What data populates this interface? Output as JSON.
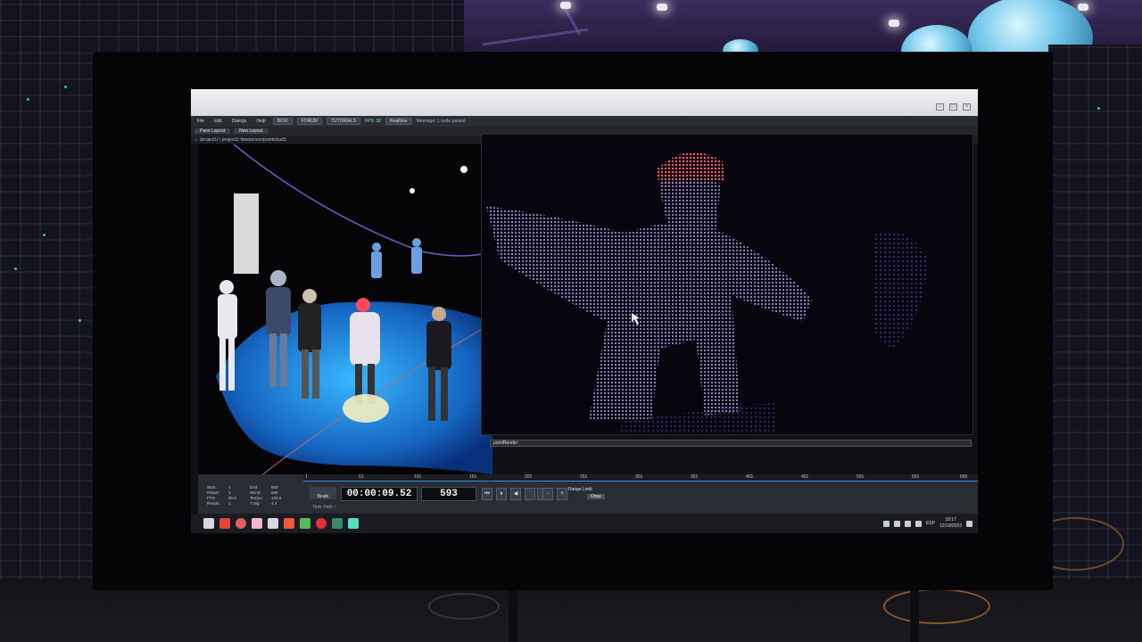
{
  "window": {
    "status_message": "Message: 1 node pasted",
    "fps_label": "FPS: 30",
    "realtime_label": "Realtime"
  },
  "menus": [
    "File",
    "Edit",
    "Dialogs",
    "Help"
  ],
  "menu_pills": [
    "BOXI",
    "FORUM",
    "TUTORIALS"
  ],
  "tabs": [
    {
      "label": "Pane Layout"
    },
    {
      "label": "New Layout"
    }
  ],
  "path": "/project1/ / project1/ timesensor/pointcloud1",
  "viewer_operator_label": "pointRender",
  "timeline": {
    "timecode": "00:00:09.52",
    "frame": "593",
    "ruler_ticks": [
      "1",
      "51",
      "101",
      "151",
      "201",
      "251",
      "301",
      "351",
      "401",
      "451",
      "501",
      "551",
      "600"
    ],
    "play_mode": "Beats",
    "range_limit_label": "Range Limit",
    "once_label": "Once",
    "time_path_label": "Time Path: /",
    "stats": [
      "Start:",
      "1",
      "End:",
      "600",
      "RStart:",
      "1",
      "REnd:",
      "600",
      "FPS:",
      "60.0",
      "Tempo:",
      "120.0",
      "Resolt:",
      "1",
      "T Sig:",
      "4  4"
    ],
    "buttons": [
      "⏮",
      "⏸",
      "◀",
      "",
      "",
      "-",
      "+"
    ]
  },
  "taskbar": {
    "lang": "ESP",
    "time": "18:17",
    "date": "12/10/2023"
  },
  "colors": {
    "accent": "#3a8ee6",
    "pointcloud_left": "#1e88e5",
    "pointcloud_right": "#8d79d6",
    "hat_red": "#ff4a5a"
  }
}
